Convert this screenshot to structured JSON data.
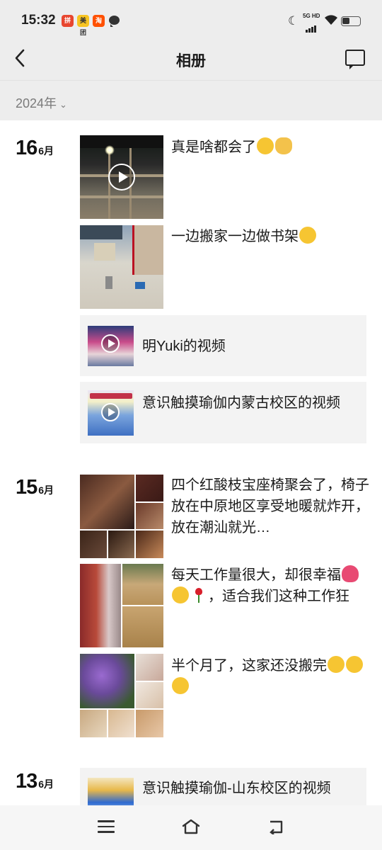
{
  "status_bar": {
    "time": "15:32",
    "apps": [
      "拼",
      "美团",
      "淘"
    ],
    "network": "5G HD"
  },
  "header": {
    "title": "相册"
  },
  "year_selector": {
    "label": "2024年"
  },
  "days": [
    {
      "day": "16",
      "month": "6月",
      "posts": [
        {
          "text": "真是啥都会了"
        },
        {
          "text": "一边搬家一边做书架"
        }
      ],
      "videos": [
        {
          "text": "明Yuki的视频"
        },
        {
          "text": "意识触摸瑜伽内蒙古校区的视频"
        }
      ]
    },
    {
      "day": "15",
      "month": "6月",
      "posts": [
        {
          "text": "四个红酸枝宝座椅聚会了，椅子放在中原地区享受地暖就炸开，放在潮汕就光…"
        },
        {
          "text_a": "每天工作量很大，却很幸福",
          "text_b": "，适合我们这种工作狂"
        },
        {
          "text": "半个月了，这家还没搬完"
        }
      ]
    },
    {
      "day": "13",
      "month": "6月",
      "videos": [
        {
          "text": "意识触摸瑜伽-山东校区的视频"
        }
      ]
    }
  ],
  "colors": {
    "header_bg": "#ededed",
    "card_bg": "#f3f3f3",
    "text": "#1a1a1a",
    "muted": "#7a7a7a"
  }
}
